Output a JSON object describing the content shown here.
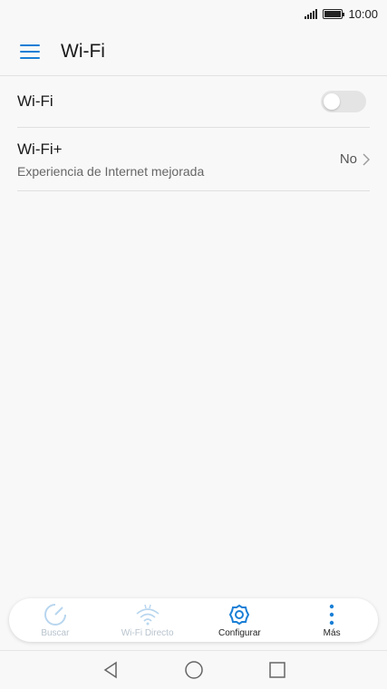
{
  "status_bar": {
    "time": "10:00"
  },
  "header": {
    "title": "Wi-Fi"
  },
  "settings": {
    "wifi": {
      "label": "Wi-Fi",
      "enabled": false
    },
    "wifi_plus": {
      "label": "Wi-Fi+",
      "subtitle": "Experiencia de Internet mejorada",
      "value": "No"
    }
  },
  "bottom_nav": {
    "items": [
      {
        "label": "Buscar",
        "icon": "scan-icon",
        "enabled": false
      },
      {
        "label": "Wi-Fi Directo",
        "icon": "wifi-direct-icon",
        "enabled": false
      },
      {
        "label": "Configurar",
        "icon": "gear-icon",
        "enabled": true
      },
      {
        "label": "Más",
        "icon": "more-vertical-icon",
        "enabled": true
      }
    ]
  },
  "colors": {
    "accent": "#1a7fd6",
    "disabled": "#b8c3cd",
    "toggle_off": "#e4e4e4"
  }
}
